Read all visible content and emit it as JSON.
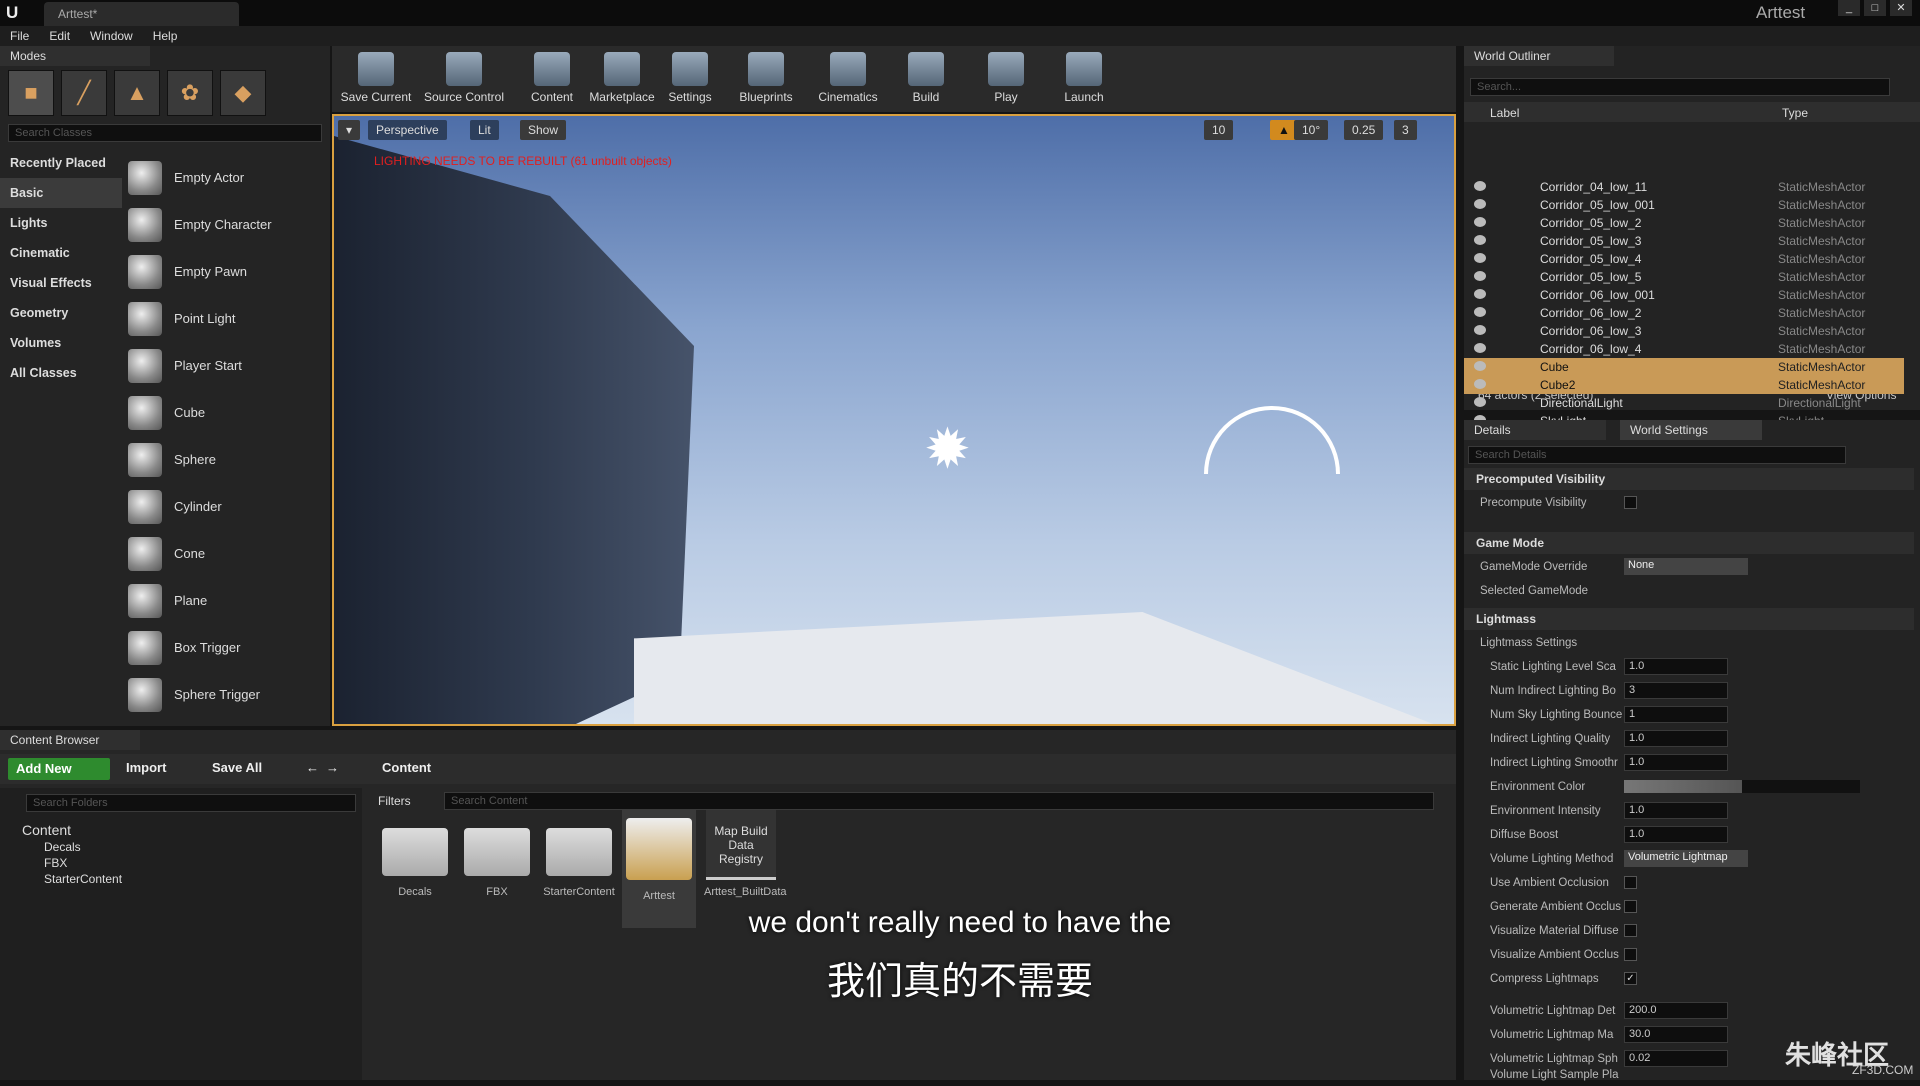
{
  "window": {
    "title": "Arttest*",
    "project": "Arttest",
    "min": "_",
    "max": "□",
    "close": "✕"
  },
  "menu": [
    "File",
    "Edit",
    "Window",
    "Help"
  ],
  "modes": {
    "tab": "Modes",
    "search_placeholder": "Search Classes",
    "categories": [
      "Recently Placed",
      "Basic",
      "Lights",
      "Cinematic",
      "Visual Effects",
      "Geometry",
      "Volumes",
      "All Classes"
    ],
    "items": [
      "Empty Actor",
      "Empty Character",
      "Empty Pawn",
      "Point Light",
      "Player Start",
      "Cube",
      "Sphere",
      "Cylinder",
      "Cone",
      "Plane",
      "Box Trigger",
      "Sphere Trigger"
    ]
  },
  "toolbar": [
    "Save Current",
    "Source Control",
    "Content",
    "Marketplace",
    "Settings",
    "Blueprints",
    "Cinematics",
    "Build",
    "Play",
    "Launch"
  ],
  "viewport": {
    "perspective": "Perspective",
    "lit": "Lit",
    "show": "Show",
    "warning": "LIGHTING NEEDS TO BE REBUILT (61 unbuilt objects)",
    "grid": "10",
    "angle": "10°",
    "scale": "0.25",
    "speed": "3"
  },
  "outliner": {
    "tab": "World Outliner",
    "search_placeholder": "Search...",
    "col_label": "Label",
    "col_type": "Type",
    "rows": [
      {
        "label": "Corridor_04_low_11",
        "type": "StaticMeshActor"
      },
      {
        "label": "Corridor_05_low_001",
        "type": "StaticMeshActor"
      },
      {
        "label": "Corridor_05_low_2",
        "type": "StaticMeshActor"
      },
      {
        "label": "Corridor_05_low_3",
        "type": "StaticMeshActor"
      },
      {
        "label": "Corridor_05_low_4",
        "type": "StaticMeshActor"
      },
      {
        "label": "Corridor_05_low_5",
        "type": "StaticMeshActor"
      },
      {
        "label": "Corridor_06_low_001",
        "type": "StaticMeshActor"
      },
      {
        "label": "Corridor_06_low_2",
        "type": "StaticMeshActor"
      },
      {
        "label": "Corridor_06_low_3",
        "type": "StaticMeshActor"
      },
      {
        "label": "Corridor_06_low_4",
        "type": "StaticMeshActor"
      },
      {
        "label": "Cube",
        "type": "StaticMeshActor"
      },
      {
        "label": "Cube2",
        "type": "StaticMeshActor"
      },
      {
        "label": "DirectionalLight",
        "type": "DirectionalLight"
      },
      {
        "label": "SkyLight",
        "type": "SkyLight"
      }
    ],
    "count": "64 actors (2 selected)",
    "view_options": "View Options"
  },
  "details": {
    "tab_details": "Details",
    "tab_world": "World Settings",
    "search_placeholder": "Search Details",
    "precomputed": "Precomputed Visibility",
    "precompute_vis": "Precompute Visibility",
    "game_mode": "Game Mode",
    "gamemode_override": "GameMode Override",
    "gamemode_value": "None",
    "selected_gamemode": "Selected GameMode",
    "lightmass": "Lightmass",
    "lightmass_settings": "Lightmass Settings",
    "props": [
      {
        "name": "Static Lighting Level Sca",
        "value": "1.0"
      },
      {
        "name": "Num Indirect Lighting Bo",
        "value": "3"
      },
      {
        "name": "Num Sky Lighting Bounce",
        "value": "1"
      },
      {
        "name": "Indirect Lighting Quality",
        "value": "1.0"
      },
      {
        "name": "Indirect Lighting Smoothr",
        "value": "1.0"
      }
    ],
    "env_color": "Environment Color",
    "props2": [
      {
        "name": "Environment Intensity",
        "value": "1.0"
      },
      {
        "name": "Diffuse Boost",
        "value": "1.0"
      }
    ],
    "volume_method": "Volume Lighting Method",
    "volume_value": "Volumetric Lightmap",
    "checks": [
      "Use Ambient Occlusion",
      "Generate Ambient Occlus",
      "Visualize Material Diffuse",
      "Visualize Ambient Occlus",
      "Compress Lightmaps"
    ],
    "props3": [
      {
        "name": "Volumetric Lightmap Det",
        "value": "200.0"
      },
      {
        "name": "Volumetric Lightmap Ma",
        "value": "30.0"
      },
      {
        "name": "Volumetric Lightmap Sph",
        "value": "0.02"
      }
    ],
    "last": "Volume Light Sample Pla"
  },
  "content": {
    "tab": "Content Browser",
    "add_new": "Add New",
    "import": "Import",
    "save_all": "Save All",
    "path": "Content",
    "folder_search": "Search Folders",
    "filters": "Filters",
    "content_search": "Search Content",
    "tree": [
      "Content",
      "Decals",
      "FBX",
      "StarterContent"
    ],
    "assets": [
      "Decals",
      "FBX",
      "StarterContent",
      "Arttest",
      "Arttest_BuiltData"
    ],
    "registry": "Map Build Data Registry"
  },
  "subtitle_en": "we don't really need to have the",
  "subtitle_zh": "我们真的不需要",
  "watermark": "朱峰社区",
  "watermark_sub": "ZF3D.COM"
}
